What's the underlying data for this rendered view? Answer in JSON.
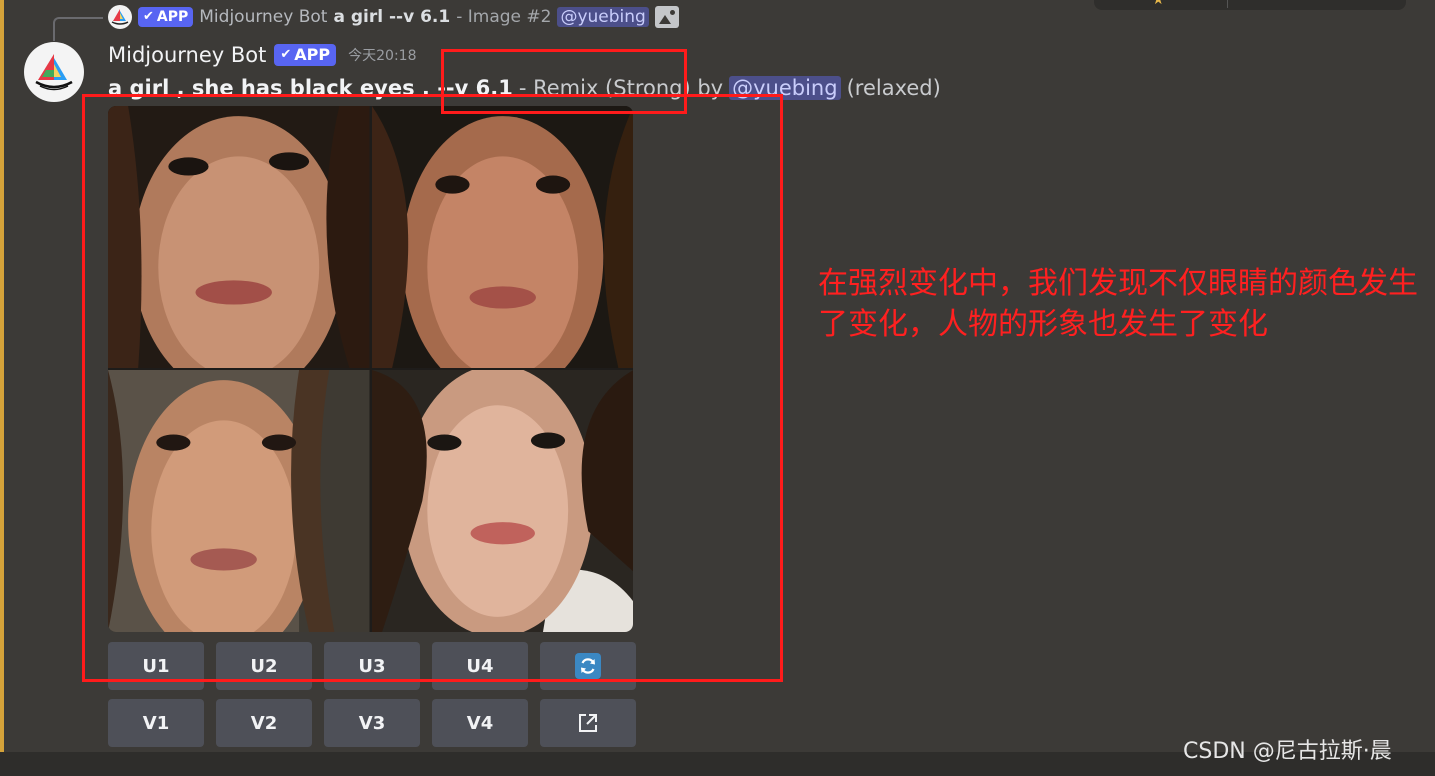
{
  "reply": {
    "bot_name": "Midjourney Bot",
    "app_label": "APP",
    "prompt": "a girl --v 6.1",
    "meta": "- Image #2",
    "mention": "@yuebing"
  },
  "message": {
    "bot_name": "Midjourney Bot",
    "app_label": "APP",
    "timestamp": "今天20:18",
    "prompt_bold": "a girl , she has black eyes . --v 6.1",
    "meta_prefix": "- Remix (Strong) by",
    "mention": "@yuebing",
    "meta_suffix": "(relaxed)"
  },
  "grid_images": [
    {
      "label": "image-1"
    },
    {
      "label": "image-2"
    },
    {
      "label": "image-3"
    },
    {
      "label": "image-4"
    }
  ],
  "buttons": {
    "row1": [
      "U1",
      "U2",
      "U3",
      "U4"
    ],
    "row2": [
      "V1",
      "V2",
      "V3",
      "V4"
    ]
  },
  "annotation": {
    "text": "在强烈变化中，我们发现不仅眼睛的颜色发生了变化，人物的形象也发生了变化"
  },
  "watermark": "CSDN @尼古拉斯·晨",
  "colors": {
    "background": "#3c3a37",
    "app_badge": "#5865f2",
    "button": "#4e5058",
    "annotation": "#ff1b1b",
    "accent_bar": "#d4a23a"
  }
}
